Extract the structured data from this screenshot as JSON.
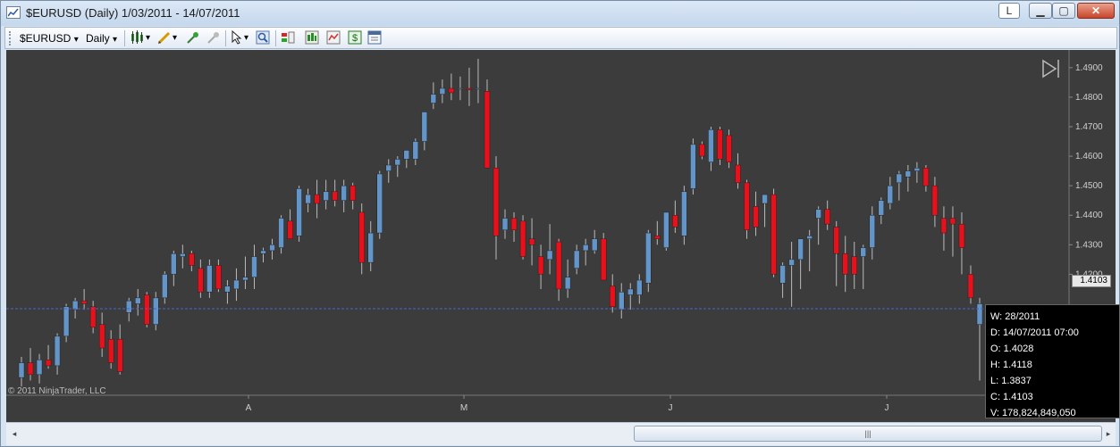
{
  "window": {
    "title": "$EURUSD (Daily)  1/03/2011 - 14/07/2011",
    "link_button": "L",
    "minimize_glyph": "▁",
    "maximize_glyph": "▢",
    "close_glyph": "✕"
  },
  "toolbar": {
    "instrument": "$EURUSD",
    "interval": "Daily",
    "dropdown_glyph": "▾",
    "icons": [
      "bar-type-icon",
      "drawing-tools-icon",
      "add-indicator-icon",
      "remove-icon",
      "cursor-icon",
      "zoom-icon",
      "strategies-icon",
      "chart-style-icon",
      "indicator-panel-icon",
      "dollar-icon",
      "properties-icon"
    ]
  },
  "chart": {
    "copyright": "© 2011 NinjaTrader, LLC",
    "y_ticks": [
      "1.4900",
      "1.4800",
      "1.4700",
      "1.4600",
      "1.4500",
      "1.4400",
      "1.4300",
      "1.4200"
    ],
    "x_ticks": [
      "A",
      "M",
      "J",
      "J"
    ],
    "last_price": "1.4103",
    "scroll_end_glyph": "▷|",
    "colors": {
      "background": "#3c3c3c",
      "up": "#6495c8",
      "down": "#e8101a",
      "wick": "#bbbbbb",
      "crosshair": "#4a63d0"
    }
  },
  "tooltip": {
    "week": "W: 28/2011",
    "date": "D: 14/07/2011 07:00",
    "open": "O: 1.4028",
    "high": "H: 1.4118",
    "low": "L: 1.3837",
    "close": "C: 1.4103",
    "volume": "V: 178,824,849,050"
  },
  "scrollbar": {
    "thumb_grip": "|||",
    "left_arrow": "◂",
    "right_arrow": "▸"
  },
  "chart_data": {
    "type": "candlestick",
    "x_ticks": [
      "A",
      "M",
      "J",
      "J"
    ],
    "y_ticks": [
      1.49,
      1.48,
      1.47,
      1.46,
      1.45,
      1.44,
      1.43,
      1.42
    ],
    "ylim": [
      1.379,
      1.496
    ],
    "last_price": 1.4103,
    "candles": [
      [
        1.385,
        1.392,
        1.382,
        1.39
      ],
      [
        1.39,
        1.395,
        1.384,
        1.386
      ],
      [
        1.386,
        1.393,
        1.383,
        1.391
      ],
      [
        1.391,
        1.396,
        1.388,
        1.389
      ],
      [
        1.389,
        1.4,
        1.386,
        1.399
      ],
      [
        1.399,
        1.41,
        1.397,
        1.409
      ],
      [
        1.408,
        1.412,
        1.405,
        1.411
      ],
      [
        1.411,
        1.415,
        1.408,
        1.41
      ],
      [
        1.409,
        1.411,
        1.4,
        1.402
      ],
      [
        1.403,
        1.407,
        1.392,
        1.395
      ],
      [
        1.398,
        1.401,
        1.388,
        1.39
      ],
      [
        1.398,
        1.403,
        1.386,
        1.387
      ],
      [
        1.407,
        1.412,
        1.404,
        1.411
      ],
      [
        1.41,
        1.415,
        1.406,
        1.412
      ],
      [
        1.413,
        1.414,
        1.402,
        1.403
      ],
      [
        1.403,
        1.414,
        1.401,
        1.412
      ],
      [
        1.412,
        1.421,
        1.41,
        1.42
      ],
      [
        1.42,
        1.428,
        1.416,
        1.427
      ],
      [
        1.426,
        1.43,
        1.422,
        1.427
      ],
      [
        1.427,
        1.428,
        1.421,
        1.423
      ],
      [
        1.422,
        1.425,
        1.412,
        1.414
      ],
      [
        1.414,
        1.425,
        1.412,
        1.423
      ],
      [
        1.423,
        1.425,
        1.414,
        1.415
      ],
      [
        1.414,
        1.418,
        1.41,
        1.416
      ],
      [
        1.415,
        1.422,
        1.411,
        1.418
      ],
      [
        1.418,
        1.426,
        1.415,
        1.419
      ],
      [
        1.419,
        1.43,
        1.415,
        1.426
      ],
      [
        1.427,
        1.429,
        1.424,
        1.428
      ],
      [
        1.428,
        1.432,
        1.425,
        1.43
      ],
      [
        1.429,
        1.44,
        1.427,
        1.439
      ],
      [
        1.438,
        1.442,
        1.435,
        1.432
      ],
      [
        1.433,
        1.45,
        1.431,
        1.449
      ],
      [
        1.444,
        1.449,
        1.441,
        1.447
      ],
      [
        1.447,
        1.452,
        1.439,
        1.444
      ],
      [
        1.445,
        1.452,
        1.442,
        1.448
      ],
      [
        1.448,
        1.452,
        1.443,
        1.445
      ],
      [
        1.445,
        1.452,
        1.441,
        1.45
      ],
      [
        1.45,
        1.451,
        1.442,
        1.445
      ],
      [
        1.441,
        1.444,
        1.42,
        1.424
      ],
      [
        1.424,
        1.438,
        1.421,
        1.434
      ],
      [
        1.434,
        1.455,
        1.432,
        1.454
      ],
      [
        1.455,
        1.459,
        1.451,
        1.457
      ],
      [
        1.457,
        1.46,
        1.453,
        1.459
      ],
      [
        1.459,
        1.461,
        1.456,
        1.462
      ],
      [
        1.459,
        1.466,
        1.457,
        1.465
      ],
      [
        1.465,
        1.472,
        1.462,
        1.475
      ],
      [
        1.478,
        1.485,
        1.476,
        1.481
      ],
      [
        1.481,
        1.486,
        1.478,
        1.483
      ],
      [
        1.483,
        1.488,
        1.479,
        1.4815
      ],
      [
        1.483,
        1.487,
        1.479,
        1.483
      ],
      [
        1.483,
        1.49,
        1.477,
        1.4825
      ],
      [
        1.483,
        1.493,
        1.478,
        1.483
      ],
      [
        1.482,
        1.486,
        1.459,
        1.456
      ],
      [
        1.456,
        1.46,
        1.425,
        1.433
      ],
      [
        1.435,
        1.442,
        1.432,
        1.439
      ],
      [
        1.439,
        1.441,
        1.431,
        1.435
      ],
      [
        1.438,
        1.44,
        1.425,
        1.426
      ],
      [
        1.432,
        1.439,
        1.423,
        1.43
      ],
      [
        1.426,
        1.43,
        1.415,
        1.42
      ],
      [
        1.425,
        1.437,
        1.42,
        1.428
      ],
      [
        1.431,
        1.432,
        1.411,
        1.415
      ],
      [
        1.415,
        1.425,
        1.412,
        1.419
      ],
      [
        1.422,
        1.43,
        1.42,
        1.428
      ],
      [
        1.428,
        1.432,
        1.423,
        1.43
      ],
      [
        1.428,
        1.435,
        1.427,
        1.432
      ],
      [
        1.432,
        1.434,
        1.418,
        1.418
      ],
      [
        1.416,
        1.42,
        1.407,
        1.409
      ],
      [
        1.408,
        1.417,
        1.405,
        1.414
      ],
      [
        1.413,
        1.417,
        1.408,
        1.415
      ],
      [
        1.413,
        1.42,
        1.41,
        1.418
      ],
      [
        1.417,
        1.435,
        1.414,
        1.434
      ],
      [
        1.433,
        1.438,
        1.43,
        1.432
      ],
      [
        1.429,
        1.438,
        1.428,
        1.441
      ],
      [
        1.44,
        1.445,
        1.434,
        1.436
      ],
      [
        1.433,
        1.45,
        1.43,
        1.448
      ],
      [
        1.449,
        1.466,
        1.447,
        1.464
      ],
      [
        1.464,
        1.465,
        1.459,
        1.46
      ],
      [
        1.458,
        1.47,
        1.455,
        1.469
      ],
      [
        1.469,
        1.47,
        1.457,
        1.459
      ],
      [
        1.467,
        1.469,
        1.456,
        1.458
      ],
      [
        1.457,
        1.461,
        1.449,
        1.451
      ],
      [
        1.451,
        1.452,
        1.432,
        1.435
      ],
      [
        1.443,
        1.448,
        1.433,
        1.436
      ],
      [
        1.444,
        1.447,
        1.436,
        1.447
      ],
      [
        1.447,
        1.449,
        1.419,
        1.42
      ],
      [
        1.417,
        1.424,
        1.412,
        1.423
      ],
      [
        1.423,
        1.431,
        1.409,
        1.425
      ],
      [
        1.425,
        1.432,
        1.415,
        1.432
      ],
      [
        1.432,
        1.435,
        1.421,
        1.433
      ],
      [
        1.439,
        1.443,
        1.43,
        1.442
      ],
      [
        1.442,
        1.445,
        1.435,
        1.437
      ],
      [
        1.436,
        1.438,
        1.416,
        1.427
      ],
      [
        1.427,
        1.433,
        1.414,
        1.42
      ],
      [
        1.426,
        1.431,
        1.415,
        1.42
      ],
      [
        1.426,
        1.43,
        1.415,
        1.429
      ],
      [
        1.429,
        1.443,
        1.425,
        1.44
      ],
      [
        1.44,
        1.446,
        1.437,
        1.445
      ],
      [
        1.444,
        1.453,
        1.442,
        1.45
      ],
      [
        1.451,
        1.455,
        1.445,
        1.454
      ],
      [
        1.453,
        1.457,
        1.448,
        1.455
      ],
      [
        1.455,
        1.458,
        1.451,
        1.456
      ],
      [
        1.456,
        1.457,
        1.448,
        1.45
      ],
      [
        1.45,
        1.453,
        1.436,
        1.44
      ],
      [
        1.439,
        1.443,
        1.428,
        1.434
      ],
      [
        1.439,
        1.443,
        1.426,
        1.437
      ],
      [
        1.437,
        1.441,
        1.42,
        1.429
      ],
      [
        1.42,
        1.423,
        1.41,
        1.412
      ],
      [
        1.403,
        1.412,
        1.384,
        1.41
      ]
    ]
  }
}
